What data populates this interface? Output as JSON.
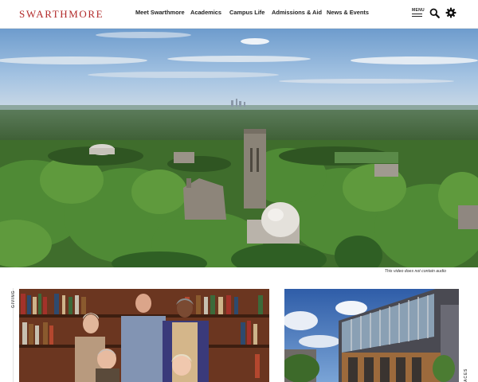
{
  "header": {
    "logo": "SWARTHMORE",
    "nav": [
      "Meet Swarthmore",
      "Academics",
      "Campus Life",
      "Admissions & Aid",
      "News & Events"
    ],
    "menu_label": "MENU",
    "icons": [
      "search-icon",
      "gear-icon"
    ]
  },
  "hero": {
    "video_note": "This video does not contain audio"
  },
  "sections": {
    "giving_label": "GIVING",
    "right_label": "ACES"
  },
  "colors": {
    "brand": "#b22a2a",
    "sky": "#8fb6dc",
    "foliage": "#3f6d2c"
  }
}
